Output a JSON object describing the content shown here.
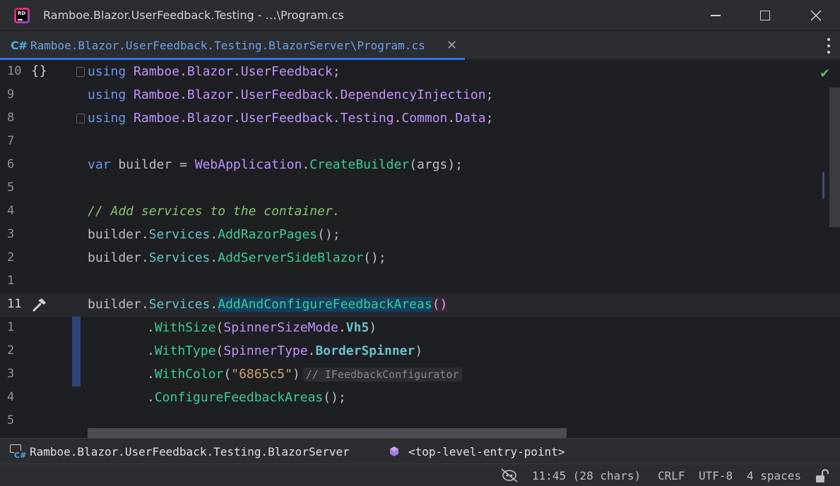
{
  "window": {
    "title": "Ramboe.Blazor.UserFeedback.Testing - …\\Program.cs",
    "logo_text": "RD"
  },
  "tab": {
    "language": "C#",
    "label": "Ramboe.Blazor.UserFeedback.Testing.BlazorServer\\Program.cs",
    "close_glyph": "✕"
  },
  "editor": {
    "line_numbers": [
      "10",
      "9",
      "8",
      "7",
      "6",
      "5",
      "4",
      "3",
      "2",
      "1",
      "11",
      "1",
      "2",
      "3",
      "4",
      "5"
    ],
    "code": {
      "l1_kw": "using",
      "l1_ns1": "Ramboe",
      "l1_ns2": "Blazor",
      "l1_ns3": "UserFeedback",
      "l2_kw": "using",
      "l2_ns1": "Ramboe",
      "l2_ns2": "Blazor",
      "l2_ns3": "UserFeedback",
      "l2_ns4": "DependencyInjection",
      "l3_kw": "using",
      "l3_ns1": "Ramboe",
      "l3_ns2": "Blazor",
      "l3_ns3": "UserFeedback",
      "l3_ns4": "Testing",
      "l3_ns5": "Common",
      "l3_ns6": "Data",
      "l5_kw": "var",
      "l5_var": " builder = ",
      "l5_cls": "WebApplication",
      "l5_mth": "CreateBuilder",
      "l5_args": "(args);",
      "l7_comment": "// Add services to the container.",
      "l8_obj": "builder",
      "l8_prop": "Services",
      "l8_mth": "AddRazorPages",
      "l8_end": "();",
      "l9_obj": "builder",
      "l9_prop": "Services",
      "l9_mth": "AddServerSideBlazor",
      "l9_end": "();",
      "l11_obj": "builder",
      "l11_prop": "Services",
      "l11_mth": "AddAndConfigureFeedbackAreas",
      "l11_paren": "()",
      "l12_mth": "WithSize",
      "l12_type": "SpinnerSizeMode",
      "l12_member": "Vh5",
      "l13_mth": "WithType",
      "l13_type": "SpinnerType",
      "l13_member": "BorderSpinner",
      "l14_mth": "WithColor",
      "l14_str": "\"6865c5\"",
      "l14_hint": "// IFeedbackConfigurator",
      "l15_mth": "ConfigureFeedbackAreas",
      "l15_end": "();"
    }
  },
  "breadcrumb": {
    "project": "Ramboe.Blazor.UserFeedback.Testing.BlazorServer",
    "entry": "<top-level-entry-point>"
  },
  "status": {
    "position": "11:45 (28 chars)",
    "line_ending": "CRLF",
    "encoding": "UTF-8",
    "indent": "4 spaces"
  },
  "colors": {
    "accent": "#3574f0",
    "keyword": "#6c95eb",
    "namespace": "#c191ff",
    "method": "#39cc9b",
    "comment": "#85c46c",
    "string": "#c9a26d",
    "check": "#5fb865"
  }
}
